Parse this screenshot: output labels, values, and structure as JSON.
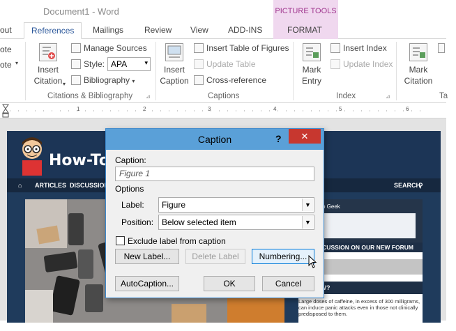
{
  "titlebar": {
    "doc_title": "Document1 - Word",
    "picture_tools": "PICTURE TOOLS"
  },
  "tabs": {
    "out": "out",
    "references": "References",
    "mailings": "Mailings",
    "review": "Review",
    "view": "View",
    "addins": "ADD-INS",
    "format": "FORMAT"
  },
  "ribbon": {
    "left_cut1": "ote",
    "left_cut2": "ote",
    "insert_citation_1": "Insert",
    "insert_citation_2": "Citation",
    "manage_sources": "Manage Sources",
    "style_label": "Style:",
    "style_value": "APA",
    "bibliography": "Bibliography",
    "citations_group": "Citations & Bibliography",
    "insert_caption_1": "Insert",
    "insert_caption_2": "Caption",
    "insert_table_figures": "Insert Table of Figures",
    "update_table": "Update Table",
    "cross_reference": "Cross-reference",
    "captions_group": "Captions",
    "mark_entry_1": "Mark",
    "mark_entry_2": "Entry",
    "insert_index": "Insert Index",
    "update_index": "Update Index",
    "index_group": "Index",
    "mark_citation_1": "Mark",
    "mark_citation_2": "Citation",
    "right_cut": "Ta"
  },
  "ruler": {
    "marks": [
      "1",
      "2",
      "3",
      "4",
      "5",
      "6"
    ]
  },
  "site": {
    "logo": "How-To G",
    "nav_articles": "ARTICLES",
    "nav_discussion": "DISCUSSION",
    "nav_search": "SEARCH",
    "side_geek": "To Geek",
    "side_banner": "DISCUSSION ON OUR NEW FORUM",
    "side_how": "HOW?",
    "side_text": "Large doses of caffeine, in excess of 300 milligrams, can induce panic attacks even in those not clinically predisposed to them."
  },
  "dialog": {
    "title": "Caption",
    "help": "?",
    "close": "✕",
    "caption_label": "Caption:",
    "caption_value": "Figure 1",
    "options_label": "Options",
    "label_label": "Label:",
    "label_value": "Figure",
    "position_label": "Position:",
    "position_value": "Below selected item",
    "exclude_label": "Exclude label from caption",
    "exclude_checked": false,
    "new_label_btn": "New Label...",
    "delete_label_btn": "Delete Label",
    "numbering_btn": "Numbering...",
    "autocaption_btn": "AutoCaption...",
    "ok_btn": "OK",
    "cancel_btn": "Cancel"
  },
  "colors": {
    "accent": "#2b579a",
    "picture_tools": "#a0378f",
    "close": "#c7372f",
    "dialog_title": "#5aa0d8"
  }
}
